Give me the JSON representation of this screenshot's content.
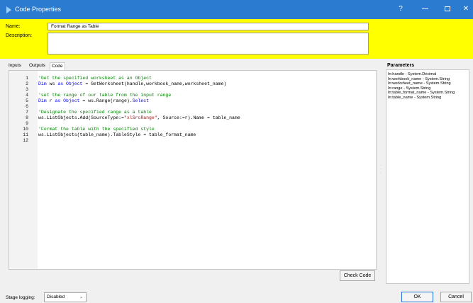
{
  "window": {
    "title": "Code Properties",
    "controls": {
      "help": "?"
    }
  },
  "header": {
    "name_label": "Name:",
    "name_value": "Format Range as Table",
    "description_label": "Description:",
    "description_value": ""
  },
  "tabs": [
    {
      "label": "Inputs",
      "active": false
    },
    {
      "label": "Outputs",
      "active": false
    },
    {
      "label": "Code",
      "active": true
    }
  ],
  "editor": {
    "lines": [
      {
        "num": "1",
        "tokens": [
          {
            "t": "'Get the specified worksheet as an Object",
            "c": "cmt"
          }
        ]
      },
      {
        "num": "2",
        "tokens": [
          {
            "t": "Dim",
            "c": "kw"
          },
          {
            "t": " ws ",
            "c": ""
          },
          {
            "t": "as",
            "c": "kw"
          },
          {
            "t": " ",
            "c": ""
          },
          {
            "t": "Object",
            "c": "kw"
          },
          {
            "t": " = GetWorksheet(handle,workbook_name,worksheet_name)",
            "c": ""
          }
        ]
      },
      {
        "num": "3",
        "tokens": []
      },
      {
        "num": "4",
        "tokens": [
          {
            "t": "'set the range of our table from the input range",
            "c": "cmt"
          }
        ]
      },
      {
        "num": "5",
        "tokens": [
          {
            "t": "Dim",
            "c": "kw"
          },
          {
            "t": " r ",
            "c": ""
          },
          {
            "t": "as",
            "c": "kw"
          },
          {
            "t": " ",
            "c": ""
          },
          {
            "t": "Object",
            "c": "kw"
          },
          {
            "t": " = ws.Range(range).",
            "c": ""
          },
          {
            "t": "Select",
            "c": "kw"
          }
        ]
      },
      {
        "num": "6",
        "tokens": []
      },
      {
        "num": "7",
        "tokens": [
          {
            "t": "'Designate the specified range as a table",
            "c": "cmt"
          }
        ]
      },
      {
        "num": "8",
        "tokens": [
          {
            "t": "ws.ListObjects.Add(SourceType:=",
            "c": ""
          },
          {
            "t": "\"xlSrcRange\"",
            "c": "str"
          },
          {
            "t": ", Source:=r).Name = table_name",
            "c": ""
          }
        ]
      },
      {
        "num": "9",
        "tokens": []
      },
      {
        "num": "10",
        "tokens": [
          {
            "t": "'Format the table with the specified style",
            "c": "cmt"
          }
        ]
      },
      {
        "num": "11",
        "tokens": [
          {
            "t": "ws.ListObjects(table_name).TableStyle = table_format_name",
            "c": ""
          }
        ]
      },
      {
        "num": "12",
        "tokens": []
      }
    ]
  },
  "check_code_label": "Check Code",
  "parameters": {
    "title": "Parameters",
    "items": [
      "In:handle - System.Decimal",
      "In:workbook_name - System.String",
      "In:worksheet_name - System.String",
      "In:range - System.String",
      "In:table_format_name - System.String",
      "In:table_name - System.String"
    ]
  },
  "footer": {
    "stage_logging_label": "Stage logging:",
    "stage_logging_value": "Disabled",
    "ok_label": "OK",
    "cancel_label": "Cancel"
  },
  "colors": {
    "titlebar": "#2b7bd1",
    "header_background": "#ffff00",
    "comment": "#008000",
    "keyword": "#0000ff",
    "string": "#a31515"
  }
}
